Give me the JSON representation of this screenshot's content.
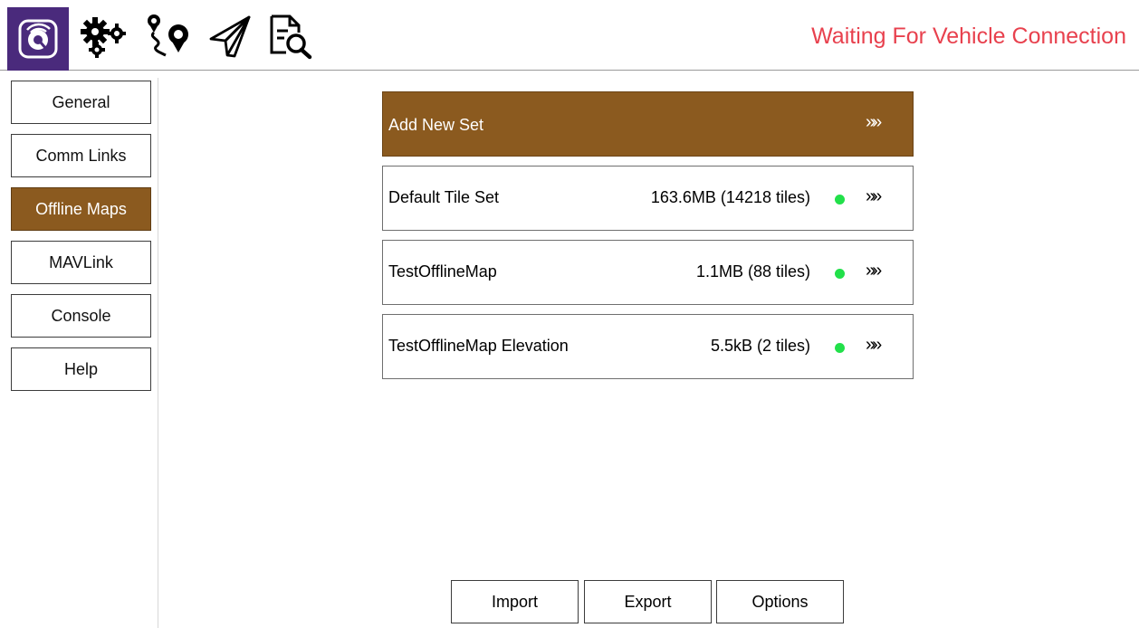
{
  "toolbar": {
    "icons": [
      "qgc-logo-icon",
      "vehicle-setup-gears-icon",
      "plan-route-icon",
      "fly-paper-plane-icon",
      "analyze-document-icon"
    ],
    "status_text": "Waiting For Vehicle Connection",
    "status_color": "#e8414e"
  },
  "sidebar": {
    "items": [
      {
        "label": "General"
      },
      {
        "label": "Comm Links"
      },
      {
        "label": "Offline Maps",
        "active": true
      },
      {
        "label": "MAVLink"
      },
      {
        "label": "Console"
      },
      {
        "label": "Help"
      }
    ]
  },
  "offline_maps": {
    "add_label": "Add New Set",
    "chevron": "»»",
    "sets": [
      {
        "name": "Default Tile Set",
        "size": "163.6MB (14218 tiles)",
        "status": "complete"
      },
      {
        "name": "TestOfflineMap",
        "size": "1.1MB (88 tiles)",
        "status": "complete"
      },
      {
        "name": "TestOfflineMap Elevation",
        "size": "5.5kB (2 tiles)",
        "status": "complete"
      }
    ]
  },
  "actions": {
    "import_label": "Import",
    "export_label": "Export",
    "options_label": "Options"
  },
  "colors": {
    "accent": "#8b5a1f",
    "logo_bg": "#4a2a7c",
    "status_dot": "#22e04a"
  }
}
